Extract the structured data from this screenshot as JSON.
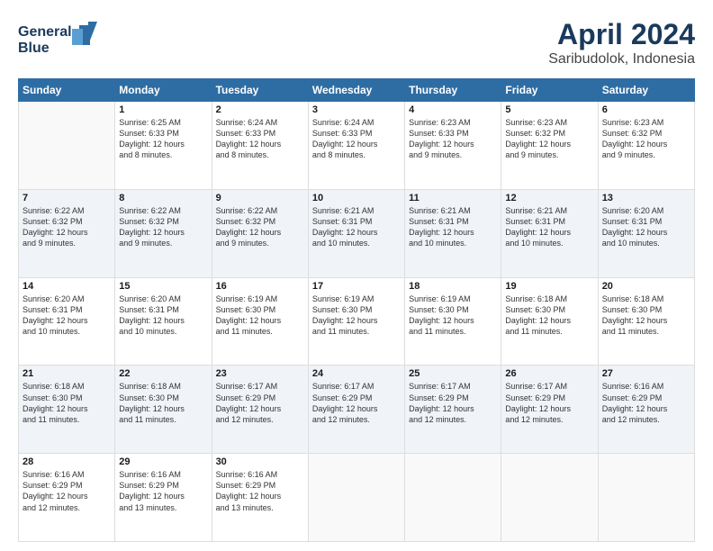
{
  "header": {
    "logo_line1": "General",
    "logo_line2": "Blue",
    "title": "April 2024",
    "subtitle": "Saribudolok, Indonesia"
  },
  "days_of_week": [
    "Sunday",
    "Monday",
    "Tuesday",
    "Wednesday",
    "Thursday",
    "Friday",
    "Saturday"
  ],
  "weeks": [
    [
      {
        "day": "",
        "info": ""
      },
      {
        "day": "1",
        "info": "Sunrise: 6:25 AM\nSunset: 6:33 PM\nDaylight: 12 hours\nand 8 minutes."
      },
      {
        "day": "2",
        "info": "Sunrise: 6:24 AM\nSunset: 6:33 PM\nDaylight: 12 hours\nand 8 minutes."
      },
      {
        "day": "3",
        "info": "Sunrise: 6:24 AM\nSunset: 6:33 PM\nDaylight: 12 hours\nand 8 minutes."
      },
      {
        "day": "4",
        "info": "Sunrise: 6:23 AM\nSunset: 6:33 PM\nDaylight: 12 hours\nand 9 minutes."
      },
      {
        "day": "5",
        "info": "Sunrise: 6:23 AM\nSunset: 6:32 PM\nDaylight: 12 hours\nand 9 minutes."
      },
      {
        "day": "6",
        "info": "Sunrise: 6:23 AM\nSunset: 6:32 PM\nDaylight: 12 hours\nand 9 minutes."
      }
    ],
    [
      {
        "day": "7",
        "info": "Sunrise: 6:22 AM\nSunset: 6:32 PM\nDaylight: 12 hours\nand 9 minutes."
      },
      {
        "day": "8",
        "info": "Sunrise: 6:22 AM\nSunset: 6:32 PM\nDaylight: 12 hours\nand 9 minutes."
      },
      {
        "day": "9",
        "info": "Sunrise: 6:22 AM\nSunset: 6:32 PM\nDaylight: 12 hours\nand 9 minutes."
      },
      {
        "day": "10",
        "info": "Sunrise: 6:21 AM\nSunset: 6:31 PM\nDaylight: 12 hours\nand 10 minutes."
      },
      {
        "day": "11",
        "info": "Sunrise: 6:21 AM\nSunset: 6:31 PM\nDaylight: 12 hours\nand 10 minutes."
      },
      {
        "day": "12",
        "info": "Sunrise: 6:21 AM\nSunset: 6:31 PM\nDaylight: 12 hours\nand 10 minutes."
      },
      {
        "day": "13",
        "info": "Sunrise: 6:20 AM\nSunset: 6:31 PM\nDaylight: 12 hours\nand 10 minutes."
      }
    ],
    [
      {
        "day": "14",
        "info": "Sunrise: 6:20 AM\nSunset: 6:31 PM\nDaylight: 12 hours\nand 10 minutes."
      },
      {
        "day": "15",
        "info": "Sunrise: 6:20 AM\nSunset: 6:31 PM\nDaylight: 12 hours\nand 10 minutes."
      },
      {
        "day": "16",
        "info": "Sunrise: 6:19 AM\nSunset: 6:30 PM\nDaylight: 12 hours\nand 11 minutes."
      },
      {
        "day": "17",
        "info": "Sunrise: 6:19 AM\nSunset: 6:30 PM\nDaylight: 12 hours\nand 11 minutes."
      },
      {
        "day": "18",
        "info": "Sunrise: 6:19 AM\nSunset: 6:30 PM\nDaylight: 12 hours\nand 11 minutes."
      },
      {
        "day": "19",
        "info": "Sunrise: 6:18 AM\nSunset: 6:30 PM\nDaylight: 12 hours\nand 11 minutes."
      },
      {
        "day": "20",
        "info": "Sunrise: 6:18 AM\nSunset: 6:30 PM\nDaylight: 12 hours\nand 11 minutes."
      }
    ],
    [
      {
        "day": "21",
        "info": "Sunrise: 6:18 AM\nSunset: 6:30 PM\nDaylight: 12 hours\nand 11 minutes."
      },
      {
        "day": "22",
        "info": "Sunrise: 6:18 AM\nSunset: 6:30 PM\nDaylight: 12 hours\nand 11 minutes."
      },
      {
        "day": "23",
        "info": "Sunrise: 6:17 AM\nSunset: 6:29 PM\nDaylight: 12 hours\nand 12 minutes."
      },
      {
        "day": "24",
        "info": "Sunrise: 6:17 AM\nSunset: 6:29 PM\nDaylight: 12 hours\nand 12 minutes."
      },
      {
        "day": "25",
        "info": "Sunrise: 6:17 AM\nSunset: 6:29 PM\nDaylight: 12 hours\nand 12 minutes."
      },
      {
        "day": "26",
        "info": "Sunrise: 6:17 AM\nSunset: 6:29 PM\nDaylight: 12 hours\nand 12 minutes."
      },
      {
        "day": "27",
        "info": "Sunrise: 6:16 AM\nSunset: 6:29 PM\nDaylight: 12 hours\nand 12 minutes."
      }
    ],
    [
      {
        "day": "28",
        "info": "Sunrise: 6:16 AM\nSunset: 6:29 PM\nDaylight: 12 hours\nand 12 minutes."
      },
      {
        "day": "29",
        "info": "Sunrise: 6:16 AM\nSunset: 6:29 PM\nDaylight: 12 hours\nand 13 minutes."
      },
      {
        "day": "30",
        "info": "Sunrise: 6:16 AM\nSunset: 6:29 PM\nDaylight: 12 hours\nand 13 minutes."
      },
      {
        "day": "",
        "info": ""
      },
      {
        "day": "",
        "info": ""
      },
      {
        "day": "",
        "info": ""
      },
      {
        "day": "",
        "info": ""
      }
    ]
  ]
}
